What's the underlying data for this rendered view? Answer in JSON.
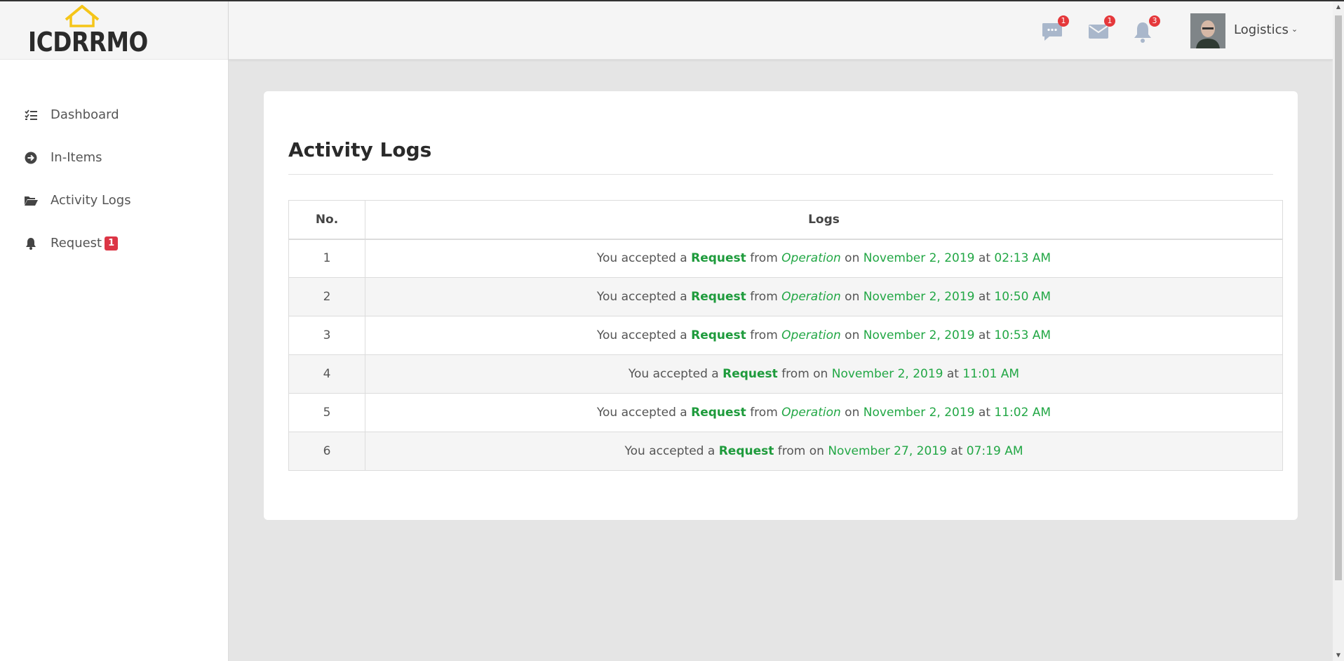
{
  "brand": {
    "name": "ICDRRMO"
  },
  "colors": {
    "accent_green": "#22a745",
    "badge_red": "#dc3545",
    "logo_yellow": "#f5c518"
  },
  "sidebar": {
    "items": [
      {
        "label": "Dashboard",
        "icon": "tasks-list-icon"
      },
      {
        "label": "In-Items",
        "icon": "arrow-circle-right-icon"
      },
      {
        "label": "Activity Logs",
        "icon": "folder-open-icon"
      },
      {
        "label": "Request",
        "icon": "bell-icon",
        "badge": "1"
      }
    ]
  },
  "header": {
    "messages_count": "1",
    "mail_count": "1",
    "notifications_count": "3",
    "user_name": "Logistics",
    "user_menu_chevron": "⌄"
  },
  "main": {
    "title": "Activity Logs",
    "table": {
      "headers": [
        "No.",
        "Logs"
      ],
      "rows": [
        {
          "no": "1",
          "prefix": "You accepted a",
          "action": "Request",
          "from": "from",
          "source": "Operation",
          "on": "on",
          "date": "November 2, 2019",
          "at": "at",
          "time": "02:13 AM"
        },
        {
          "no": "2",
          "prefix": "You accepted a",
          "action": "Request",
          "from": "from",
          "source": "Operation",
          "on": "on",
          "date": "November 2, 2019",
          "at": "at",
          "time": "10:50 AM"
        },
        {
          "no": "3",
          "prefix": "You accepted a",
          "action": "Request",
          "from": "from",
          "source": "Operation",
          "on": "on",
          "date": "November 2, 2019",
          "at": "at",
          "time": "10:53 AM"
        },
        {
          "no": "4",
          "prefix": "You accepted a",
          "action": "Request",
          "from": "from",
          "source": "",
          "on": "on",
          "date": "November 2, 2019",
          "at": "at",
          "time": "11:01 AM"
        },
        {
          "no": "5",
          "prefix": "You accepted a",
          "action": "Request",
          "from": "from",
          "source": "Operation",
          "on": "on",
          "date": "November 2, 2019",
          "at": "at",
          "time": "11:02 AM"
        },
        {
          "no": "6",
          "prefix": "You accepted a",
          "action": "Request",
          "from": "from",
          "source": "",
          "on": "on",
          "date": "November 27, 2019",
          "at": "at",
          "time": "07:19 AM"
        }
      ]
    }
  }
}
